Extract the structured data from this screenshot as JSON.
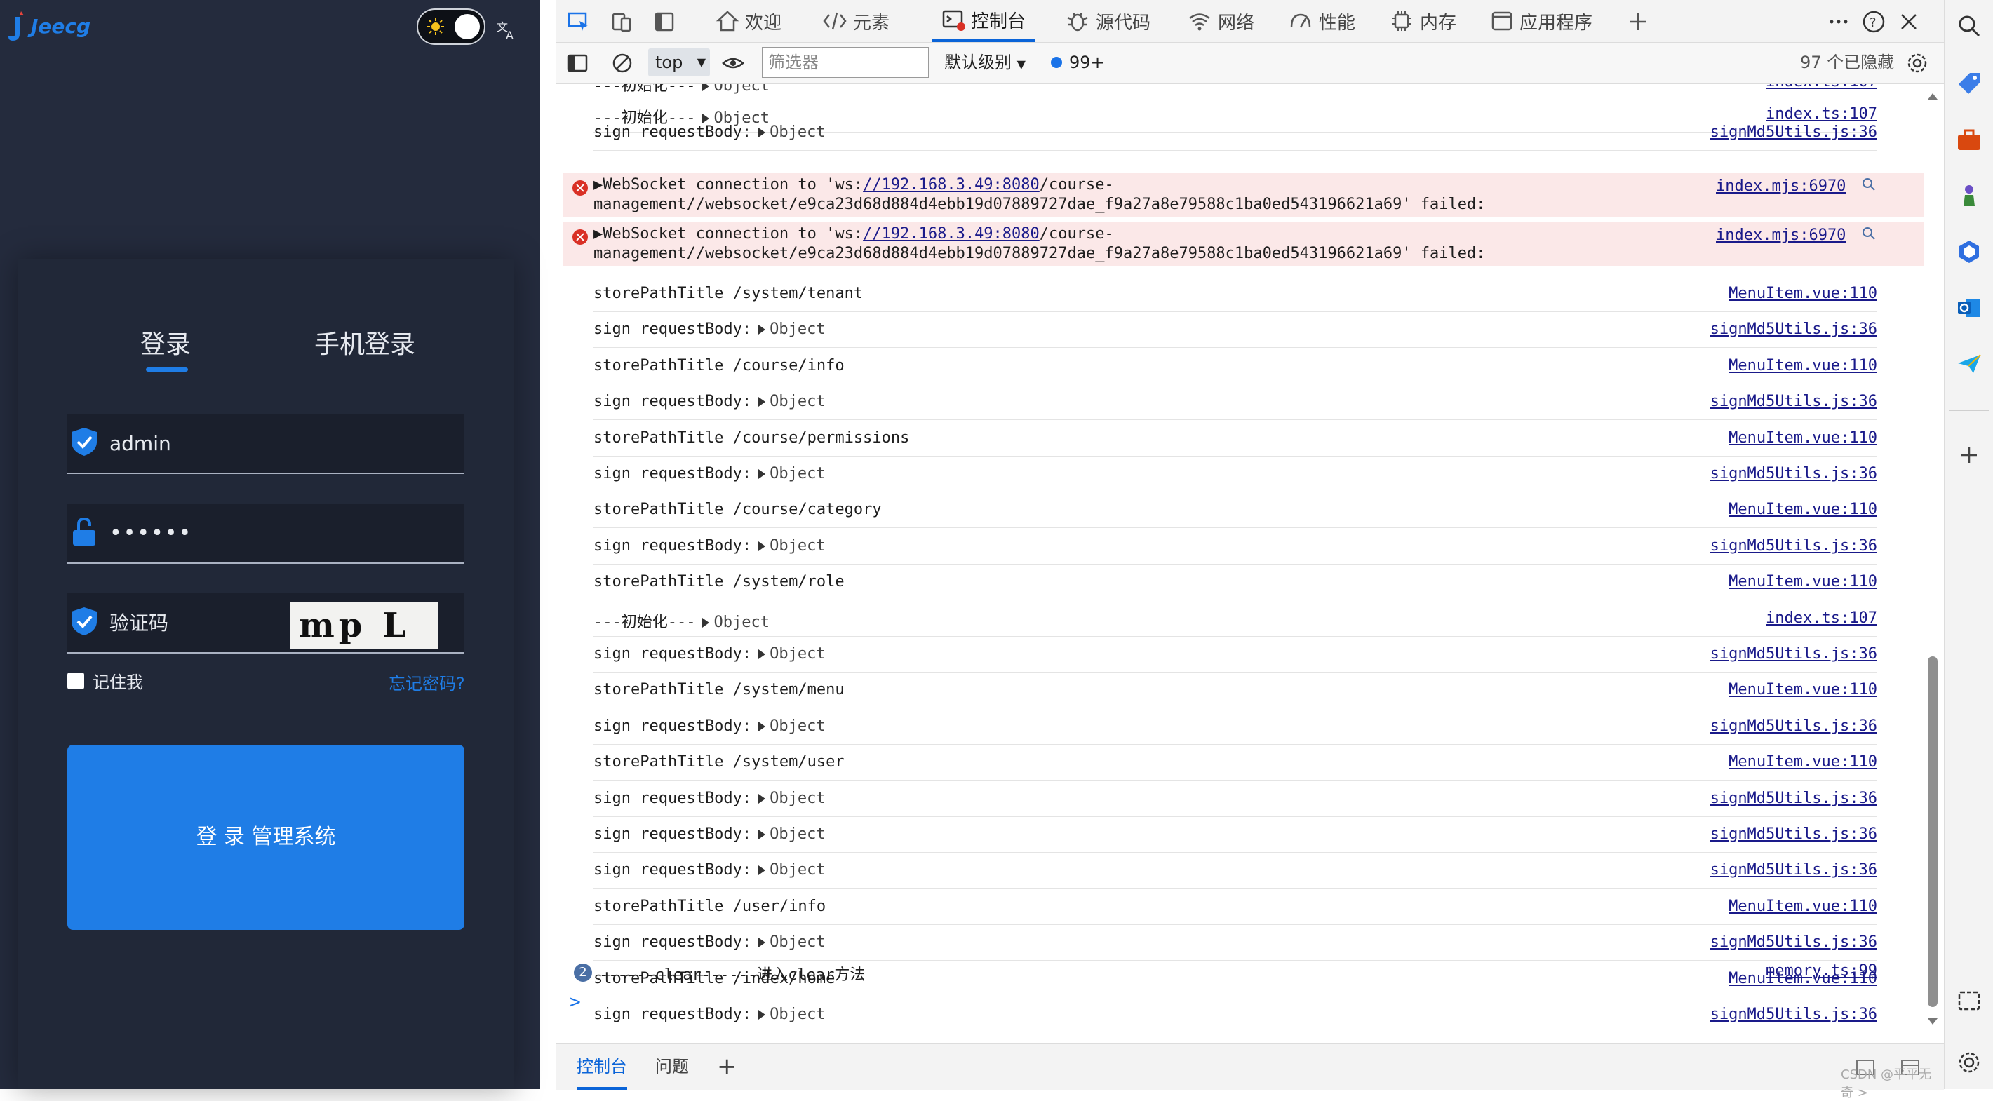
{
  "app": {
    "brand": "Jeecg",
    "tabs": {
      "account": "登录",
      "phone": "手机登录"
    },
    "username": "admin",
    "password_mask": "••••••",
    "captcha_placeholder": "验证码",
    "captcha_text": "mp L Y",
    "remember_label": "记住我",
    "forgot_label": "忘记密码?",
    "login_button": "登 录 管理系统",
    "accent": "#1f7de6"
  },
  "devtools": {
    "tabs": [
      "欢迎",
      "元素",
      "控制台",
      "源代码",
      "网络",
      "性能",
      "内存",
      "应用程序"
    ],
    "active_tab": "控制台",
    "context": "top",
    "filter_placeholder": "筛选器",
    "level": "默认级别",
    "message_count": "99+",
    "hidden": "97 个已隐藏",
    "rows": [
      {
        "text": "---初始化---",
        "object": "Object",
        "source": "index.ts:107"
      },
      {
        "text": "sign requestBody:",
        "object": "Object",
        "source": "signMd5Utils.js:36"
      },
      {
        "text": "storePathTitle /system/tenant",
        "object": "",
        "source": "MenuItem.vue:110"
      },
      {
        "text": "sign requestBody:",
        "object": "Object",
        "source": "signMd5Utils.js:36"
      },
      {
        "text": "storePathTitle /course/info",
        "object": "",
        "source": "MenuItem.vue:110"
      },
      {
        "text": "sign requestBody:",
        "object": "Object",
        "source": "signMd5Utils.js:36"
      },
      {
        "text": "storePathTitle /course/permissions",
        "object": "",
        "source": "MenuItem.vue:110"
      },
      {
        "text": "sign requestBody:",
        "object": "Object",
        "source": "signMd5Utils.js:36"
      },
      {
        "text": "storePathTitle /course/category",
        "object": "",
        "source": "MenuItem.vue:110"
      },
      {
        "text": "sign requestBody:",
        "object": "Object",
        "source": "signMd5Utils.js:36"
      },
      {
        "text": "storePathTitle /system/role",
        "object": "",
        "source": "MenuItem.vue:110"
      },
      {
        "text": "---初始化---",
        "object": "Object",
        "source": "index.ts:107"
      },
      {
        "text": "sign requestBody:",
        "object": "Object",
        "source": "signMd5Utils.js:36"
      },
      {
        "text": "storePathTitle /system/menu",
        "object": "",
        "source": "MenuItem.vue:110"
      },
      {
        "text": "sign requestBody:",
        "object": "Object",
        "source": "signMd5Utils.js:36"
      },
      {
        "text": "storePathTitle /system/user",
        "object": "",
        "source": "MenuItem.vue:110"
      },
      {
        "text": "sign requestBody:",
        "object": "Object",
        "source": "signMd5Utils.js:36"
      },
      {
        "text": "sign requestBody:",
        "object": "Object",
        "source": "signMd5Utils.js:36"
      },
      {
        "text": "sign requestBody:",
        "object": "Object",
        "source": "signMd5Utils.js:36"
      },
      {
        "text": "storePathTitle /user/info",
        "object": "",
        "source": "MenuItem.vue:110"
      },
      {
        "text": "sign requestBody:",
        "object": "Object",
        "source": "signMd5Utils.js:36"
      },
      {
        "text": "storePathTitle /index/home",
        "object": "",
        "source": "MenuItem.vue:110"
      },
      {
        "text": "sign requestBody:",
        "object": "Object",
        "source": "signMd5Utils.js:36"
      }
    ],
    "errors": [
      {
        "prefix": "WebSocket connection to 'ws:",
        "url": "//192.168.3.49:8080",
        "rest": "/course-",
        "line2": "management//websocket/e9ca23d68d884d4ebb19d07889727dae_f9a27a8e79588c1ba0ed543196621a69' failed:",
        "source": "index.mjs:6970"
      },
      {
        "prefix": "WebSocket connection to 'ws:",
        "url": "//192.168.3.49:8080",
        "rest": "/course-",
        "line2": "management//websocket/e9ca23d68d884d4ebb19d07889727dae_f9a27a8e79588c1ba0ed543196621a69' failed:",
        "source": "index.mjs:6970"
      }
    ],
    "clear_row": {
      "count": "2",
      "text": "------clear------进入clear方法",
      "source": "memory.ts:99"
    },
    "drawer_tabs": {
      "console": "控制台",
      "issues": "问题",
      "add": "+"
    },
    "watermark": "CSDN @平平无奇 >"
  }
}
